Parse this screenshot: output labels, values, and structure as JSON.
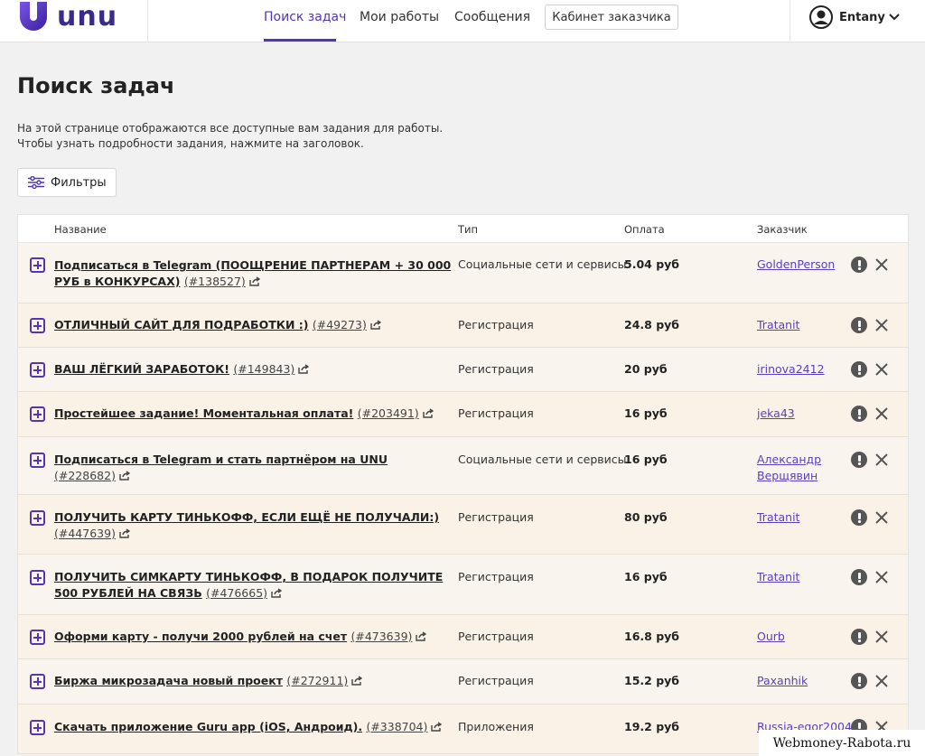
{
  "header": {
    "logo_text": "UNU",
    "nav": [
      "Поиск задач",
      "Мои работы",
      "Сообщения"
    ],
    "cabinet_button": "Кабинет заказчика",
    "user_name": "Entany"
  },
  "page": {
    "title": "Поиск задач",
    "intro_line1": "На этой странице отображаются все доступные вам задания для работы.",
    "intro_line2": "Чтобы узнать подробности задания, нажмите на заголовок.",
    "filters_label": "Фильтры"
  },
  "table": {
    "columns": [
      "Название",
      "Тип",
      "Оплата",
      "Заказчик"
    ],
    "rows": [
      {
        "title": "Подписаться в Telegram (ПООЩРЕНИЕ ПАРТНЕРАМ + 30 000 РУБ в КОНКУРСАХ)",
        "id": "(#138527)",
        "type": "Социальные сети и сервисы",
        "pay": "5.04 руб",
        "customer": "GoldenPerson"
      },
      {
        "title": "ОТЛИЧНЫЙ САЙТ ДЛЯ ПОДРАБОТКИ :)",
        "id": "(#49273)",
        "type": "Регистрация",
        "pay": "24.8 руб",
        "customer": "Tratanit"
      },
      {
        "title": "ВАШ ЛЁГКИЙ ЗАРАБОТОК!",
        "id": "(#149843)",
        "type": "Регистрация",
        "pay": "20 руб",
        "customer": "irinova2412"
      },
      {
        "title": "Простейшее задание! Моментальная оплата!",
        "id": "(#203491)",
        "type": "Регистрация",
        "pay": "16 руб",
        "customer": "jeka43"
      },
      {
        "title": "Подписаться в Telegram и стать партнёром на UNU",
        "id": "(#228682)",
        "type": "Социальные сети и сервисы",
        "pay": "16 руб",
        "customer": "Александр Верщявин"
      },
      {
        "title": "ПОЛУЧИТЬ КАРТУ ТИНЬКОФФ, ЕСЛИ ЕЩЁ НЕ ПОЛУЧАЛИ:)",
        "id": "(#447639)",
        "type": "Регистрация",
        "pay": "80 руб",
        "customer": "Tratanit"
      },
      {
        "title": "ПОЛУЧИТЬ СИМКАРТУ ТИНЬКОФФ, В ПОДАРОК ПОЛУЧИТЕ 500 РУБЛЕЙ НА СВЯЗЬ",
        "id": "(#476665)",
        "type": "Регистрация",
        "pay": "16 руб",
        "customer": "Tratanit"
      },
      {
        "title": "Оформи карту - получи 2000 рублей на счет",
        "id": "(#473639)",
        "type": "Регистрация",
        "pay": "16.8 руб",
        "customer": "Ourb"
      },
      {
        "title": "Биржа микрозадача новый проект",
        "id": "(#272911)",
        "type": "Регистрация",
        "pay": "15.2 руб",
        "customer": "Paxanhik"
      },
      {
        "title": "Скачать приложение Guru app (iOS, Андроид).",
        "id": "(#338704)",
        "type": "Приложения",
        "pay": "19.2 руб",
        "customer": "Russia-egor2004"
      }
    ]
  },
  "watermark": "Webmoney-Rabota.ru",
  "colors": {
    "accent": "#5436b5",
    "row_bg": "#fbf2e7"
  }
}
